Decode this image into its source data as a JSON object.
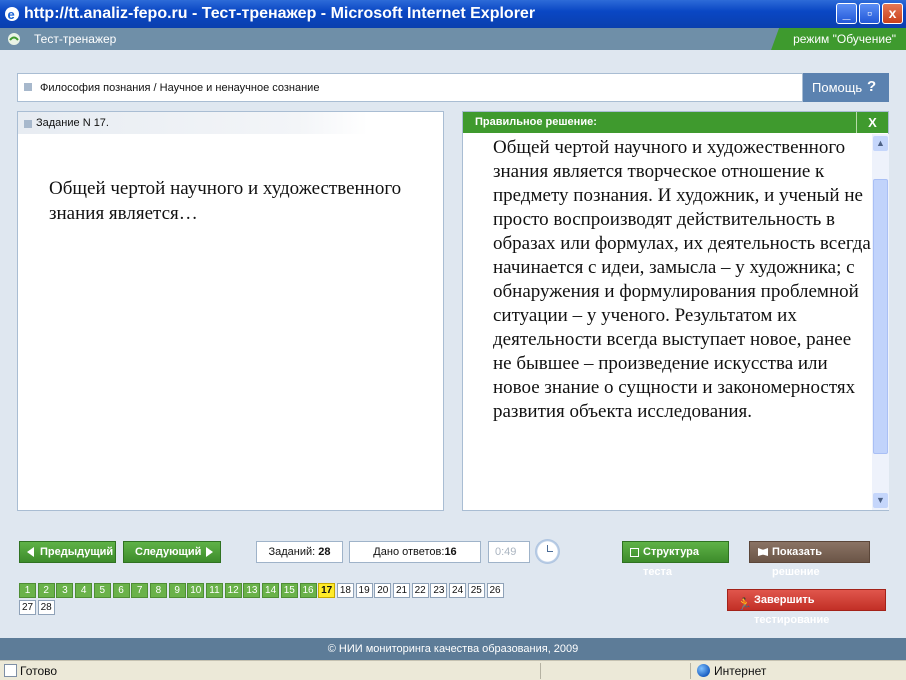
{
  "window": {
    "title": "http://tt.analiz-fepo.ru - Тест-тренажер - Microsoft Internet Explorer",
    "min": "_",
    "max": "▫",
    "close": "x"
  },
  "app": {
    "title": "Тест-тренажер",
    "mode": "режим \"Обучение\""
  },
  "breadcrumb": "Философия познания / Научное и ненаучное сознание",
  "help": {
    "label": "Помощь",
    "icon": "?"
  },
  "task": {
    "header": "Задание N 17.",
    "question": "Общей чертой научного и художественного знания является…"
  },
  "solution": {
    "header": "Правильное решение:",
    "close": "X",
    "text": "Общей чертой научного и художественного знания является творческое отношение к предмету познания. И художник, и ученый не просто воспроизводят  действительность в образах или формулах, их деятельность всегда начинается с идеи, замысла – у художника; с обнаружения и формулирования  проблемной ситуации – у ученого. Результатом их деятельности всегда выступает новое, ранее не бывшее – произведение искусства или новое знание о сущности и закономерностях развития объекта исследования."
  },
  "nav": {
    "prev": "Предыдущий",
    "next": "Следующий",
    "tasks_label": "Заданий:",
    "tasks_count": "28",
    "given_label": "Дано ответов:",
    "given_count": "16",
    "timer": "0:49",
    "structure": "Структура теста",
    "show_solution": "Показать решение",
    "finish": "Завершить тестирование"
  },
  "grid": {
    "total": 28,
    "answered": 16,
    "current": 17,
    "cells": [
      "1",
      "2",
      "3",
      "4",
      "5",
      "6",
      "7",
      "8",
      "9",
      "10",
      "11",
      "12",
      "13",
      "14",
      "15",
      "16",
      "17",
      "18",
      "19",
      "20",
      "21",
      "22",
      "23",
      "24",
      "25",
      "26",
      "27",
      "28"
    ]
  },
  "footer": "© НИИ мониторинга качества образования, 2009",
  "status": {
    "text": "Готово",
    "zone": "Интернет"
  },
  "colors": {
    "green": "#3f9a2e",
    "blue_header": "#6f8fa8",
    "current": "#ffeb2a",
    "finish": "#c22f26"
  }
}
